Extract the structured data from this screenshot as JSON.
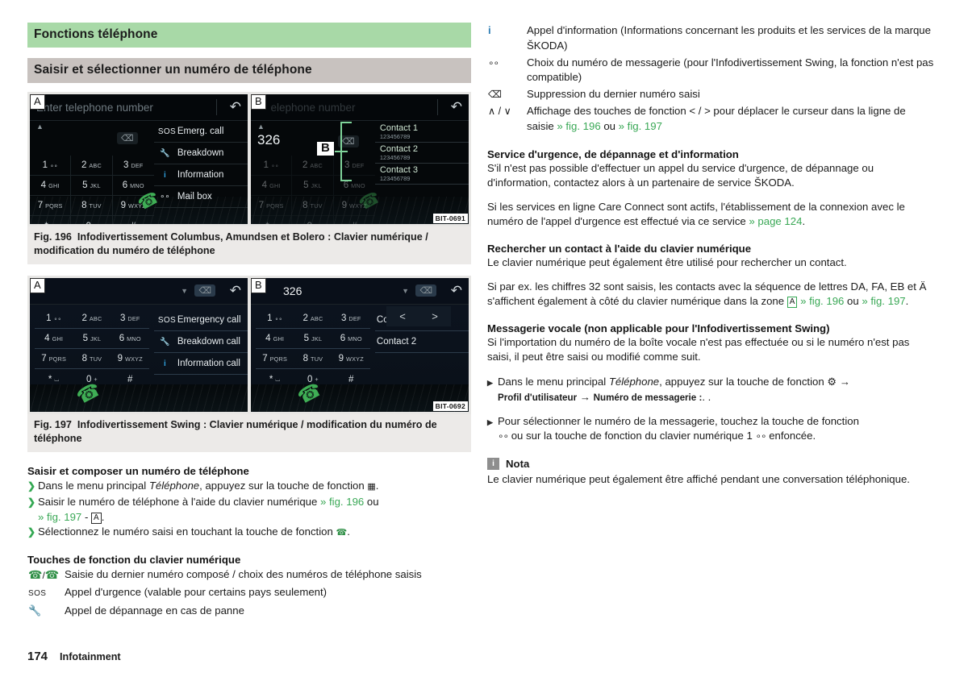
{
  "header": {
    "chapter_title": "Fonctions téléphone",
    "section_title": "Saisir et sélectionner un numéro de téléphone"
  },
  "colors": {
    "chapter_bar": "#a8d9a7",
    "section_bar": "#c8c2bf",
    "reference_green": "#34a853",
    "figure_bg": "#e8e7e5",
    "screen_bg": "#05080a",
    "info_icon_blue": "#2f9fdb",
    "phone_green": "#3fae55",
    "callout_green": "#7fd39a",
    "note_icon_grey": "#8e8e8e"
  },
  "figures": [
    {
      "id": "fig-196",
      "code": "BIT-0691",
      "caption_number": "Fig. 196",
      "caption_text": "Infodivertissement Columbus, Amundsen et Bolero : Clavier numérique / modification du numéro de téléphone",
      "screens": [
        {
          "badge": "A",
          "input_placeholder": "Enter telephone number",
          "input_value": "",
          "back_icon": "back-arrow-icon",
          "delete_icon": "backspace-icon",
          "caret_icon": "caret-up-icon",
          "phone_icon": "phone-handset-icon",
          "keys": [
            {
              "digit": "1",
              "letters": "∘∘"
            },
            {
              "digit": "2",
              "letters": "ABC"
            },
            {
              "digit": "3",
              "letters": "DEF"
            },
            {
              "digit": "4",
              "letters": "GHI"
            },
            {
              "digit": "5",
              "letters": "JKL"
            },
            {
              "digit": "6",
              "letters": "MNO"
            },
            {
              "digit": "7",
              "letters": "PQRS"
            },
            {
              "digit": "8",
              "letters": "TUV"
            },
            {
              "digit": "9",
              "letters": "WXYZ"
            },
            {
              "digit": "*",
              "letters": "⌴"
            },
            {
              "digit": "0",
              "letters": "+"
            },
            {
              "digit": "#",
              "letters": ""
            }
          ],
          "side_items": [
            {
              "icon": "sos-icon",
              "label": "Emerg. call"
            },
            {
              "icon": "wrench-icon",
              "label": "Breakdown"
            },
            {
              "icon": "info-icon",
              "label": "Information"
            },
            {
              "icon": "voicemail-icon",
              "label": "Mail box"
            }
          ],
          "contacts": []
        },
        {
          "badge": "B",
          "callout": "B",
          "input_placeholder": "elephone number",
          "input_value": "326",
          "chevron": ">",
          "back_icon": "back-arrow-icon",
          "delete_icon": "backspace-icon",
          "caret_icon": "caret-up-icon",
          "phone_icon": "phone-handset-icon",
          "keys": [
            {
              "digit": "1",
              "letters": "∘∘"
            },
            {
              "digit": "2",
              "letters": "ABC"
            },
            {
              "digit": "3",
              "letters": "DEF"
            },
            {
              "digit": "4",
              "letters": "GHI"
            },
            {
              "digit": "5",
              "letters": "JKL"
            },
            {
              "digit": "6",
              "letters": "MNO"
            },
            {
              "digit": "7",
              "letters": "PQRS"
            },
            {
              "digit": "8",
              "letters": "TUV"
            },
            {
              "digit": "9",
              "letters": "WXYZ"
            },
            {
              "digit": "*",
              "letters": "⌴"
            },
            {
              "digit": "0",
              "letters": "+"
            },
            {
              "digit": "#",
              "letters": ""
            }
          ],
          "side_items": [],
          "contacts": [
            {
              "name": "Contact 1",
              "number": "123456789"
            },
            {
              "name": "Contact 2",
              "number": "123456789"
            },
            {
              "name": "Contact 3",
              "number": "123456789"
            }
          ]
        }
      ]
    },
    {
      "id": "fig-197",
      "code": "BIT-0692",
      "caption_number": "Fig. 197",
      "caption_text": "Infodivertissement Swing : Clavier numérique / modification du numéro de téléphone",
      "screens": [
        {
          "badge": "A",
          "input_placeholder": "",
          "input_value": "",
          "back_icon": "back-arrow-icon",
          "delete_icon": "backspace-icon",
          "phone_icon": "phone-handset-icon",
          "keys": [
            {
              "digit": "1",
              "letters": "∘∘"
            },
            {
              "digit": "2",
              "letters": "ABC"
            },
            {
              "digit": "3",
              "letters": "DEF"
            },
            {
              "digit": "4",
              "letters": "GHI"
            },
            {
              "digit": "5",
              "letters": "JKL"
            },
            {
              "digit": "6",
              "letters": "MNO"
            },
            {
              "digit": "7",
              "letters": "PQRS"
            },
            {
              "digit": "8",
              "letters": "TUV"
            },
            {
              "digit": "9",
              "letters": "WXYZ"
            },
            {
              "digit": "*",
              "letters": "⌴"
            },
            {
              "digit": "0",
              "letters": "+"
            },
            {
              "digit": "#",
              "letters": ""
            }
          ],
          "side_items": [
            {
              "icon": "sos-icon",
              "label": "Emergency call"
            },
            {
              "icon": "wrench-icon",
              "label": "Breakdown call"
            },
            {
              "icon": "info-icon",
              "label": "Information call"
            }
          ],
          "contacts": []
        },
        {
          "badge": "B",
          "input_placeholder": "",
          "input_value": "326",
          "back_icon": "back-arrow-icon",
          "delete_icon": "backspace-icon",
          "phone_icon": "phone-handset-icon",
          "cursor_left": "<",
          "cursor_right": ">",
          "keys": [
            {
              "digit": "1",
              "letters": "∘∘"
            },
            {
              "digit": "2",
              "letters": "ABC"
            },
            {
              "digit": "3",
              "letters": "DEF"
            },
            {
              "digit": "4",
              "letters": "GHI"
            },
            {
              "digit": "5",
              "letters": "JKL"
            },
            {
              "digit": "6",
              "letters": "MNO"
            },
            {
              "digit": "7",
              "letters": "PQRS"
            },
            {
              "digit": "8",
              "letters": "TUV"
            },
            {
              "digit": "9",
              "letters": "WXYZ"
            },
            {
              "digit": "*",
              "letters": "⌴"
            },
            {
              "digit": "0",
              "letters": "+"
            },
            {
              "digit": "#",
              "letters": ""
            }
          ],
          "side_items": [],
          "contacts": [
            {
              "name": "Contact 1",
              "number": ""
            },
            {
              "name": "Contact 2",
              "number": ""
            }
          ]
        }
      ]
    }
  ],
  "left_column": {
    "dial_heading": "Saisir et composer un numéro de téléphone",
    "dial_steps": [
      "Dans le menu principal Téléphone, appuyez sur la touche de fonction ▦.",
      "Saisir le numéro de téléphone à l'aide du clavier numérique » fig. 196 ou » fig. 197 - A .",
      "Sélectionnez le numéro saisi en touchant la touche de fonction ✆."
    ],
    "step1_pre": "Dans le menu principal ",
    "step1_italic": "Téléphone",
    "step1_post": ", appuyez sur la touche de fonction",
    "step1_end": ".",
    "step2_pre": "Saisir le numéro de téléphone à l'aide du clavier numérique ",
    "step2_ref1": "» fig. 196",
    "step2_mid": " ou",
    "step2_ref2": "» fig. 197",
    "step2_dash": "-",
    "step2_box": "A",
    "step2_end": ".",
    "step3_pre": "Sélectionnez le numéro saisi en touchant la touche de fonction",
    "step3_end": ".",
    "fnkeys_heading": "Touches de fonction du clavier numérique",
    "fnkeys": [
      {
        "icon": "phone-handset-icon / phone-handset-icon",
        "text": "Saisie du dernier numéro composé / choix des numéros de téléphone saisis"
      },
      {
        "icon": "sos-icon",
        "text": "Appel d'urgence (valable pour certains pays seulement)"
      },
      {
        "icon": "wrench-icon",
        "text": "Appel de dépannage en cas de panne"
      }
    ]
  },
  "right_column": {
    "fnkeys_cont": [
      {
        "icon": "info-icon",
        "text": "Appel d'information (Informations concernant les produits et les services de la marque ŠKODA)"
      },
      {
        "icon": "voicemail-icon",
        "text": "Choix du numéro de messagerie (pour l'Infodivertissement Swing, la fonction n'est pas compatible)"
      },
      {
        "icon": "backspace-icon",
        "text": "Suppression du dernier numéro saisi"
      }
    ],
    "cursor_row": {
      "icon": "∧ / ∨",
      "text_pre": "Affichage des touches de fonction < / > pour déplacer le curseur dans la ligne de saisie ",
      "ref1": "» fig. 196",
      "mid": " ou ",
      "ref2": "» fig. 197"
    },
    "emergency": {
      "heading": "Service d'urgence, de dépannage et d'information",
      "para1": "S'il n'est pas possible d'effectuer un appel du service d'urgence, de dépannage ou d'information, contactez alors à un partenaire de service ŠKODA.",
      "para2_pre": "Si les services en ligne Care Connect sont actifs, l'établissement de la connexion avec le numéro de l'appel d'urgence est effectué via ce service ",
      "para2_ref": "» page 124",
      "para2_end": "."
    },
    "search": {
      "heading": "Rechercher un contact à l'aide du clavier numérique",
      "para1": "Le clavier numérique peut également être utilisé pour rechercher un contact.",
      "para2_pre": "Si par ex. les chiffres 32 sont saisis, les contacts avec la séquence de lettres DA, FA, EB et Ä s'affichent également à côté du clavier numérique dans la zone ",
      "para2_box": "A",
      "para2_ref1": "» fig. 196",
      "para2_mid": " ou ",
      "para2_ref2": "» fig. 197",
      "para2_end": "."
    },
    "voicemail": {
      "heading": "Messagerie vocale (non applicable pour l'Infodivertissement Swing)",
      "para1": "Si l'importation du numéro de la boîte vocale n'est pas effectuée ou si le numéro n'est pas saisi, il peut être saisi ou modifié comme suit.",
      "bullet1_pre": "Dans le menu principal ",
      "bullet1_italic": "Téléphone",
      "bullet1_post": ", appuyez sur la touche de fonction",
      "bullet1_arrow1": "→",
      "bullet1_path1": "Profil d'utilisateur",
      "bullet1_arrow2": "→",
      "bullet1_path2": "Numéro de messagerie :",
      "bullet1_end": ". .",
      "bullet2_pre": "Pour sélectionner le numéro de la messagerie, touchez la touche de fonction",
      "bullet2_mid": "ou sur la touche de fonction du clavier numérique 1",
      "bullet2_end": "enfoncée."
    },
    "note": {
      "label": "Nota",
      "text": "Le clavier numérique peut également être affiché pendant une conversation téléphonique."
    }
  },
  "footer": {
    "page_number": "174",
    "section": "Infotainment"
  }
}
